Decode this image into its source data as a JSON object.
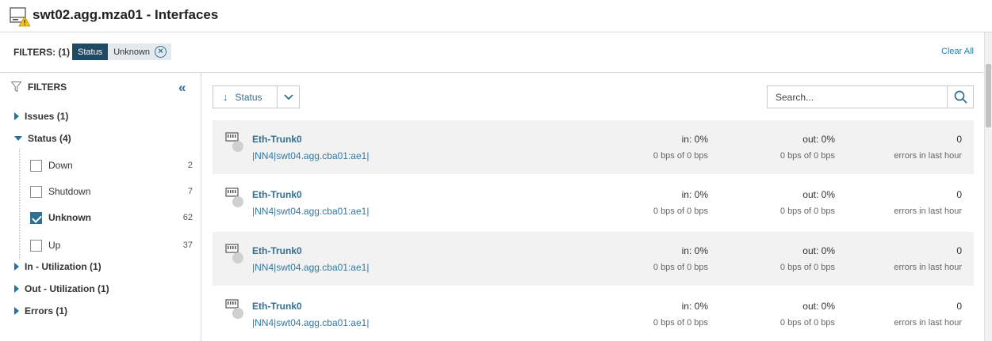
{
  "header": {
    "title": "swt02.agg.mza01 - Interfaces",
    "node_icon": "network-node-warning-icon"
  },
  "filterbar": {
    "label": "FILTERS: (1)",
    "chip_key": "Status",
    "chip_value": "Unknown",
    "chip_remove": "×",
    "clear_all": "Clear All"
  },
  "sidebar": {
    "title": "FILTERS",
    "collapse": "«",
    "groups": {
      "issues": "Issues (1)",
      "status": "Status (4)",
      "in_util": "In - Utilization (1)",
      "out_util": "Out - Utilization (1)",
      "errors": "Errors (1)"
    },
    "status_options": [
      {
        "label": "Down",
        "count": "2",
        "checked": false
      },
      {
        "label": "Shutdown",
        "count": "7",
        "checked": false
      },
      {
        "label": "Unknown",
        "count": "62",
        "checked": true
      },
      {
        "label": "Up",
        "count": "37",
        "checked": false
      }
    ]
  },
  "toolbar": {
    "sort_label": "Status",
    "sort_arrow": "↓",
    "search_placeholder": "Search..."
  },
  "rows": [
    {
      "name": "Eth-Trunk0",
      "sub": "|NN4|swt04.agg.cba01:ae1|",
      "in": "in: 0%",
      "in_detail": "0 bps of 0 bps",
      "out": "out: 0%",
      "out_detail": "0 bps of 0 bps",
      "errors": "0",
      "errors_detail": "errors in last hour"
    },
    {
      "name": "Eth-Trunk0",
      "sub": "|NN4|swt04.agg.cba01:ae1|",
      "in": "in: 0%",
      "in_detail": "0 bps of 0 bps",
      "out": "out: 0%",
      "out_detail": "0 bps of 0 bps",
      "errors": "0",
      "errors_detail": "errors in last hour"
    },
    {
      "name": "Eth-Trunk0",
      "sub": "|NN4|swt04.agg.cba01:ae1|",
      "in": "in: 0%",
      "in_detail": "0 bps of 0 bps",
      "out": "out: 0%",
      "out_detail": "0 bps of 0 bps",
      "errors": "0",
      "errors_detail": "errors in last hour"
    },
    {
      "name": "Eth-Trunk0",
      "sub": "|NN4|swt04.agg.cba01:ae1|",
      "in": "in: 0%",
      "in_detail": "0 bps of 0 bps",
      "out": "out: 0%",
      "out_detail": "0 bps of 0 bps",
      "errors": "0",
      "errors_detail": "errors in last hour"
    }
  ],
  "colors": {
    "accent": "#2f6f8f",
    "chip_dark": "#204a63",
    "row_shade": "#f2f2f2",
    "warning": "#f5c518"
  }
}
